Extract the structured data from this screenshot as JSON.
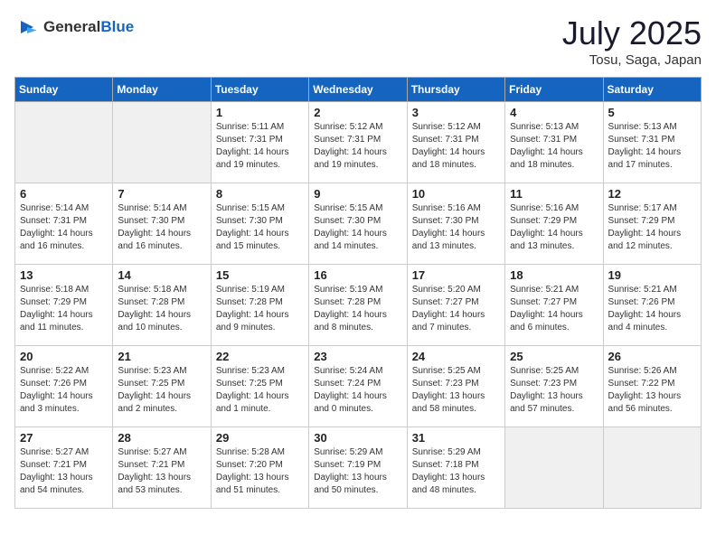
{
  "header": {
    "logo_general": "General",
    "logo_blue": "Blue",
    "month": "July 2025",
    "location": "Tosu, Saga, Japan"
  },
  "weekdays": [
    "Sunday",
    "Monday",
    "Tuesday",
    "Wednesday",
    "Thursday",
    "Friday",
    "Saturday"
  ],
  "weeks": [
    [
      {
        "day": "",
        "empty": true
      },
      {
        "day": "",
        "empty": true
      },
      {
        "day": "1",
        "sunrise": "5:11 AM",
        "sunset": "7:31 PM",
        "daylight": "14 hours and 19 minutes."
      },
      {
        "day": "2",
        "sunrise": "5:12 AM",
        "sunset": "7:31 PM",
        "daylight": "14 hours and 19 minutes."
      },
      {
        "day": "3",
        "sunrise": "5:12 AM",
        "sunset": "7:31 PM",
        "daylight": "14 hours and 18 minutes."
      },
      {
        "day": "4",
        "sunrise": "5:13 AM",
        "sunset": "7:31 PM",
        "daylight": "14 hours and 18 minutes."
      },
      {
        "day": "5",
        "sunrise": "5:13 AM",
        "sunset": "7:31 PM",
        "daylight": "14 hours and 17 minutes."
      }
    ],
    [
      {
        "day": "6",
        "sunrise": "5:14 AM",
        "sunset": "7:31 PM",
        "daylight": "14 hours and 16 minutes."
      },
      {
        "day": "7",
        "sunrise": "5:14 AM",
        "sunset": "7:30 PM",
        "daylight": "14 hours and 16 minutes."
      },
      {
        "day": "8",
        "sunrise": "5:15 AM",
        "sunset": "7:30 PM",
        "daylight": "14 hours and 15 minutes."
      },
      {
        "day": "9",
        "sunrise": "5:15 AM",
        "sunset": "7:30 PM",
        "daylight": "14 hours and 14 minutes."
      },
      {
        "day": "10",
        "sunrise": "5:16 AM",
        "sunset": "7:30 PM",
        "daylight": "14 hours and 13 minutes."
      },
      {
        "day": "11",
        "sunrise": "5:16 AM",
        "sunset": "7:29 PM",
        "daylight": "14 hours and 13 minutes."
      },
      {
        "day": "12",
        "sunrise": "5:17 AM",
        "sunset": "7:29 PM",
        "daylight": "14 hours and 12 minutes."
      }
    ],
    [
      {
        "day": "13",
        "sunrise": "5:18 AM",
        "sunset": "7:29 PM",
        "daylight": "14 hours and 11 minutes."
      },
      {
        "day": "14",
        "sunrise": "5:18 AM",
        "sunset": "7:28 PM",
        "daylight": "14 hours and 10 minutes."
      },
      {
        "day": "15",
        "sunrise": "5:19 AM",
        "sunset": "7:28 PM",
        "daylight": "14 hours and 9 minutes."
      },
      {
        "day": "16",
        "sunrise": "5:19 AM",
        "sunset": "7:28 PM",
        "daylight": "14 hours and 8 minutes."
      },
      {
        "day": "17",
        "sunrise": "5:20 AM",
        "sunset": "7:27 PM",
        "daylight": "14 hours and 7 minutes."
      },
      {
        "day": "18",
        "sunrise": "5:21 AM",
        "sunset": "7:27 PM",
        "daylight": "14 hours and 6 minutes."
      },
      {
        "day": "19",
        "sunrise": "5:21 AM",
        "sunset": "7:26 PM",
        "daylight": "14 hours and 4 minutes."
      }
    ],
    [
      {
        "day": "20",
        "sunrise": "5:22 AM",
        "sunset": "7:26 PM",
        "daylight": "14 hours and 3 minutes."
      },
      {
        "day": "21",
        "sunrise": "5:23 AM",
        "sunset": "7:25 PM",
        "daylight": "14 hours and 2 minutes."
      },
      {
        "day": "22",
        "sunrise": "5:23 AM",
        "sunset": "7:25 PM",
        "daylight": "14 hours and 1 minute."
      },
      {
        "day": "23",
        "sunrise": "5:24 AM",
        "sunset": "7:24 PM",
        "daylight": "14 hours and 0 minutes."
      },
      {
        "day": "24",
        "sunrise": "5:25 AM",
        "sunset": "7:23 PM",
        "daylight": "13 hours and 58 minutes."
      },
      {
        "day": "25",
        "sunrise": "5:25 AM",
        "sunset": "7:23 PM",
        "daylight": "13 hours and 57 minutes."
      },
      {
        "day": "26",
        "sunrise": "5:26 AM",
        "sunset": "7:22 PM",
        "daylight": "13 hours and 56 minutes."
      }
    ],
    [
      {
        "day": "27",
        "sunrise": "5:27 AM",
        "sunset": "7:21 PM",
        "daylight": "13 hours and 54 minutes."
      },
      {
        "day": "28",
        "sunrise": "5:27 AM",
        "sunset": "7:21 PM",
        "daylight": "13 hours and 53 minutes."
      },
      {
        "day": "29",
        "sunrise": "5:28 AM",
        "sunset": "7:20 PM",
        "daylight": "13 hours and 51 minutes."
      },
      {
        "day": "30",
        "sunrise": "5:29 AM",
        "sunset": "7:19 PM",
        "daylight": "13 hours and 50 minutes."
      },
      {
        "day": "31",
        "sunrise": "5:29 AM",
        "sunset": "7:18 PM",
        "daylight": "13 hours and 48 minutes."
      },
      {
        "day": "",
        "empty": true
      },
      {
        "day": "",
        "empty": true
      }
    ]
  ]
}
